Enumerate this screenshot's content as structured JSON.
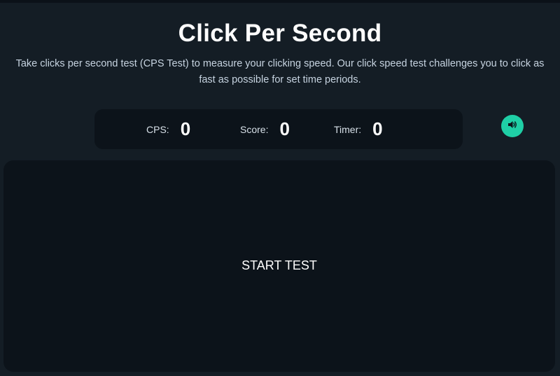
{
  "page": {
    "title": "Click Per Second",
    "subtitle": "Take clicks per second test (CPS Test) to measure your clicking speed. Our click speed test challenges you to click as fast as possible for set time periods."
  },
  "stats": {
    "cps": {
      "label": "CPS:",
      "value": "0"
    },
    "score": {
      "label": "Score:",
      "value": "0"
    },
    "timer": {
      "label": "Timer:",
      "value": "0"
    }
  },
  "sound_button": {
    "icon": "speaker-icon",
    "color": "#1fcfa6"
  },
  "click_area": {
    "label": "START TEST"
  },
  "colors": {
    "background": "#141d25",
    "panel": "#0c131a",
    "accent": "#1fcfa6"
  }
}
